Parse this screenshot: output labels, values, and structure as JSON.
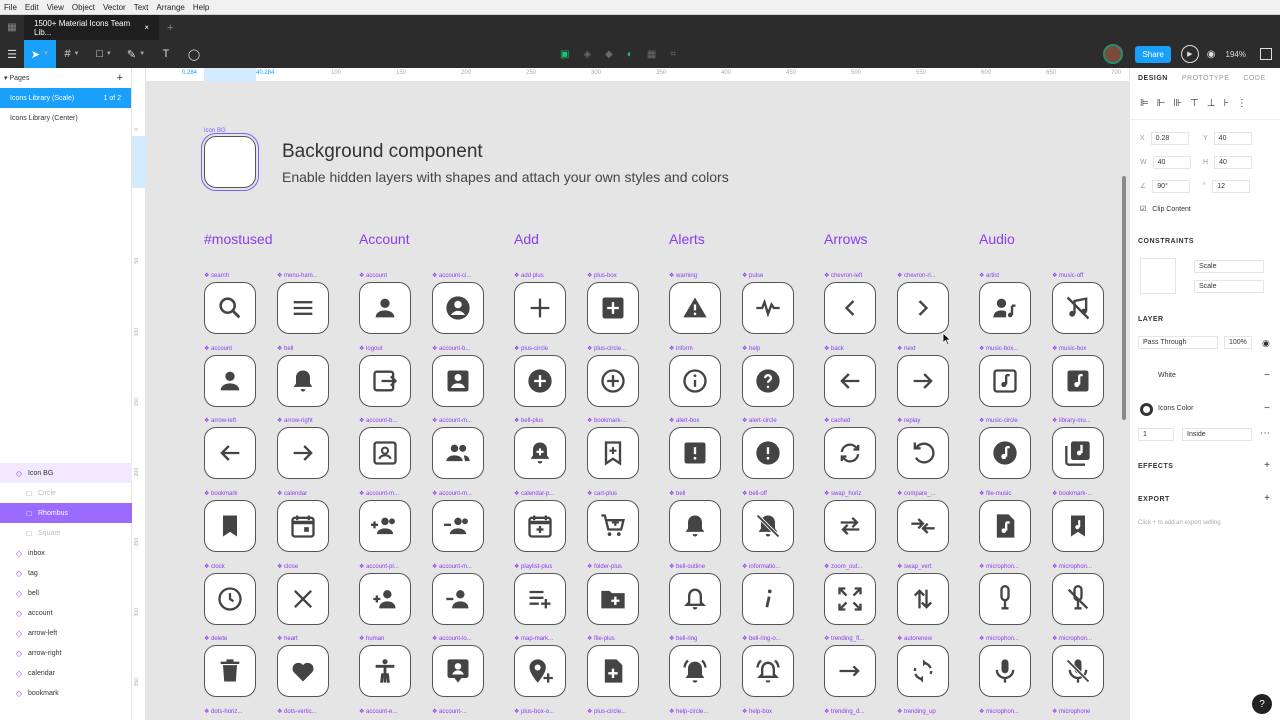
{
  "menu": [
    "File",
    "Edit",
    "View",
    "Object",
    "Vector",
    "Text",
    "Arrange",
    "Help"
  ],
  "tab": {
    "title": "1500+ Material Icons Team Lib...",
    "close": "×",
    "new": "+"
  },
  "toolbar": {
    "share": "Share",
    "zoom": "194%"
  },
  "pages": {
    "header": "Pages",
    "add": "+",
    "items": [
      {
        "label": "Icons Library (Scale)",
        "count": "1 of 2"
      },
      {
        "label": "Icons Library (Center)",
        "count": ""
      }
    ]
  },
  "layers": [
    {
      "label": "Icon BG",
      "kind": "parent"
    },
    {
      "label": "Circle",
      "kind": "faded"
    },
    {
      "label": "Rhombus",
      "kind": "selected"
    },
    {
      "label": "Square",
      "kind": "faded"
    },
    {
      "label": "inbox",
      "kind": "normal"
    },
    {
      "label": "tag",
      "kind": "normal"
    },
    {
      "label": "bell",
      "kind": "normal"
    },
    {
      "label": "account",
      "kind": "normal"
    },
    {
      "label": "arrow-left",
      "kind": "normal"
    },
    {
      "label": "arrow-right",
      "kind": "normal"
    },
    {
      "label": "calendar",
      "kind": "normal"
    },
    {
      "label": "bookmark",
      "kind": "normal"
    }
  ],
  "ruler": {
    "top": [
      "0.284",
      "40.284",
      "100",
      "150",
      "200",
      "250",
      "300",
      "350",
      "400",
      "450",
      "500",
      "550",
      "600",
      "650",
      "700"
    ],
    "left": [
      "0",
      "50",
      "100",
      "150",
      "200",
      "250",
      "300",
      "350"
    ]
  },
  "canvas": {
    "bg_label": "Icon BG",
    "title": "Background component",
    "subtitle": "Enable hidden layers with shapes and attach your own styles and colors",
    "categories": [
      "#mostused",
      "Account",
      "Add",
      "Alerts",
      "Arrows",
      "Audio"
    ],
    "rows": [
      [
        [
          "search",
          "search"
        ],
        [
          "menu-ham...",
          "menu"
        ],
        [
          "account",
          "account"
        ],
        [
          "account-ci...",
          "account-circle"
        ],
        [
          "add plus",
          "plus"
        ],
        [
          "plus-box",
          "plus-box"
        ],
        [
          "warning",
          "warning"
        ],
        [
          "pulse",
          "pulse"
        ],
        [
          "chevron-left",
          "chevron-left"
        ],
        [
          "chevron-ri...",
          "chevron-right"
        ],
        [
          "artist",
          "artist"
        ],
        [
          "music-off",
          "music-off"
        ]
      ],
      [
        [
          "account",
          "account"
        ],
        [
          "bell",
          "bell"
        ],
        [
          "logout",
          "logout"
        ],
        [
          "account-b...",
          "account-box"
        ],
        [
          "plus-circle",
          "plus-circle"
        ],
        [
          "plus-circle...",
          "plus-circle-outline"
        ],
        [
          "inform",
          "info"
        ],
        [
          "help",
          "help"
        ],
        [
          "back",
          "arrow-left"
        ],
        [
          "next",
          "arrow-right"
        ],
        [
          "music-box...",
          "music-box-outline"
        ],
        [
          "music-box",
          "music-box"
        ]
      ],
      [
        [
          "arrow-left",
          "arrow-left"
        ],
        [
          "arrow-right",
          "arrow-right"
        ],
        [
          "account-b...",
          "account-box-outline"
        ],
        [
          "account-m...",
          "account-multiple"
        ],
        [
          "bell-plus",
          "bell-plus"
        ],
        [
          "bookmark-...",
          "bookmark-plus"
        ],
        [
          "alert-box",
          "alert-box"
        ],
        [
          "alert-circle",
          "alert-circle"
        ],
        [
          "cached",
          "cached"
        ],
        [
          "replay",
          "replay"
        ],
        [
          "music-circle",
          "music-circle"
        ],
        [
          "library-mu...",
          "library-music"
        ]
      ],
      [
        [
          "bookmark",
          "bookmark"
        ],
        [
          "calendar",
          "calendar"
        ],
        [
          "account-m...",
          "account-multiple-plus"
        ],
        [
          "account-m...",
          "account-multiple-minus"
        ],
        [
          "calendar-p...",
          "calendar-plus"
        ],
        [
          "cart-plus",
          "cart-plus"
        ],
        [
          "bell",
          "bell"
        ],
        [
          "bell-off",
          "bell-off"
        ],
        [
          "swap_horiz",
          "swap-horiz"
        ],
        [
          "compare_...",
          "compare"
        ],
        [
          "file-music",
          "file-music"
        ],
        [
          "bookmark-...",
          "bookmark-music"
        ]
      ],
      [
        [
          "clock",
          "clock"
        ],
        [
          "close",
          "close"
        ],
        [
          "account-pl...",
          "account-plus"
        ],
        [
          "account-m...",
          "account-minus"
        ],
        [
          "playlist-plus",
          "playlist-plus"
        ],
        [
          "folder-plus",
          "folder-plus"
        ],
        [
          "bell-outline",
          "bell-outline"
        ],
        [
          "informatio...",
          "info-i"
        ],
        [
          "zoom_out...",
          "zoom-out-map"
        ],
        [
          "swap_vert",
          "swap-vert"
        ],
        [
          "microphon...",
          "mic-variant"
        ],
        [
          "microphon...",
          "mic-variant-off"
        ]
      ],
      [
        [
          "delete",
          "delete"
        ],
        [
          "heart",
          "heart"
        ],
        [
          "human",
          "human"
        ],
        [
          "account-lo...",
          "account-location"
        ],
        [
          "map-mark...",
          "map-marker-plus"
        ],
        [
          "file-plus",
          "file-plus"
        ],
        [
          "bell-ring",
          "bell-ring"
        ],
        [
          "bell-ring-o...",
          "bell-ring-outline"
        ],
        [
          "trending_fl...",
          "trending-flat"
        ],
        [
          "autorenew",
          "autorenew"
        ],
        [
          "microphon...",
          "mic"
        ],
        [
          "microphon...",
          "mic-off"
        ]
      ],
      [
        [
          "dots-horiz...",
          ""
        ],
        [
          "dots-vertic...",
          ""
        ],
        [
          "account-e...",
          ""
        ],
        [
          "account-...",
          ""
        ],
        [
          "plus-box-o...",
          ""
        ],
        [
          "plus-circle...",
          ""
        ],
        [
          "help-circle...",
          ""
        ],
        [
          "help-box",
          ""
        ],
        [
          "trending_d...",
          ""
        ],
        [
          "trending_up",
          ""
        ],
        [
          "microphon...",
          ""
        ],
        [
          "microphone",
          ""
        ]
      ]
    ]
  },
  "design": {
    "tabs": [
      "DESIGN",
      "PROTOTYPE",
      "CODE"
    ],
    "x": "0.28",
    "y": "40",
    "w": "40",
    "h": "40",
    "rotation": "90°",
    "radius": "12",
    "clip": "Clip Content",
    "constraints": "CONSTRAINTS",
    "scale1": "Scale",
    "scale2": "Scale",
    "layer": "LAYER",
    "blend": "Pass Through",
    "opacity": "100%",
    "fill1": "White",
    "fill2": "Icons Color",
    "stroke_w": "1",
    "stroke_pos": "Inside",
    "effects": "EFFECTS",
    "export": "EXPORT",
    "export_hint": "Click + to add an export setting",
    "help": "?"
  },
  "colors": {
    "accent": "#18a0fb",
    "purple": "#8a3cf0",
    "icon": "#444444"
  }
}
